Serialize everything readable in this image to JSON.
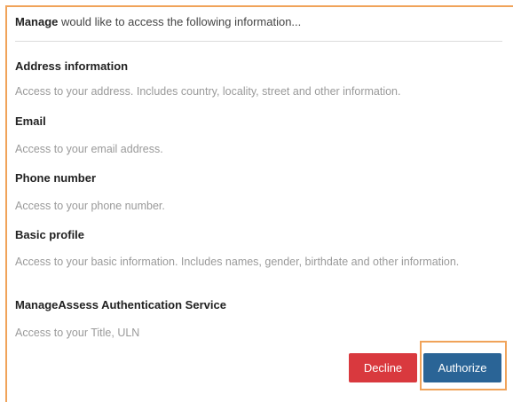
{
  "intro": {
    "app_name": "Manage",
    "text": " would like to access the following information..."
  },
  "sections": [
    {
      "title": "Address information",
      "description": "Access to your address. Includes country, locality, street and other information."
    },
    {
      "title": "Email",
      "description": "Access to your email address."
    },
    {
      "title": "Phone number",
      "description": "Access to your phone number."
    },
    {
      "title": "Basic profile",
      "description": "Access to your basic information. Includes names, gender, birthdate and other information."
    },
    {
      "title": "ManageAssess Authentication Service",
      "description": "Access to your Title, ULN"
    }
  ],
  "buttons": {
    "decline": "Decline",
    "authorize": "Authorize"
  },
  "colors": {
    "decline": "#d9393e",
    "authorize": "#2a6496",
    "highlight": "#f0a35a"
  }
}
